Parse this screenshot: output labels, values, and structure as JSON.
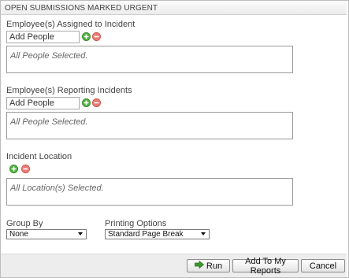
{
  "header": {
    "title": "OPEN SUBMISSIONS MARKED URGENT"
  },
  "assigned": {
    "label": "Employee(s) Assigned to Incident",
    "input_value": "Add People",
    "selection_text": "All People Selected."
  },
  "reporting": {
    "label": "Employee(s) Reporting Incidents",
    "input_value": "Add People",
    "selection_text": "All People Selected."
  },
  "location": {
    "label": "Incident Location",
    "selection_text": "All Location(s) Selected."
  },
  "group_by": {
    "label": "Group By",
    "selected": "None"
  },
  "printing": {
    "label": "Printing Options",
    "selected": "Standard Page Break"
  },
  "buttons": {
    "run": "Run",
    "add_to_reports": "Add To My Reports",
    "cancel": "Cancel"
  },
  "colors": {
    "add_icon": "#4caf3c",
    "remove_icon": "#e05a55",
    "run_icon": "#3a9a2c"
  }
}
